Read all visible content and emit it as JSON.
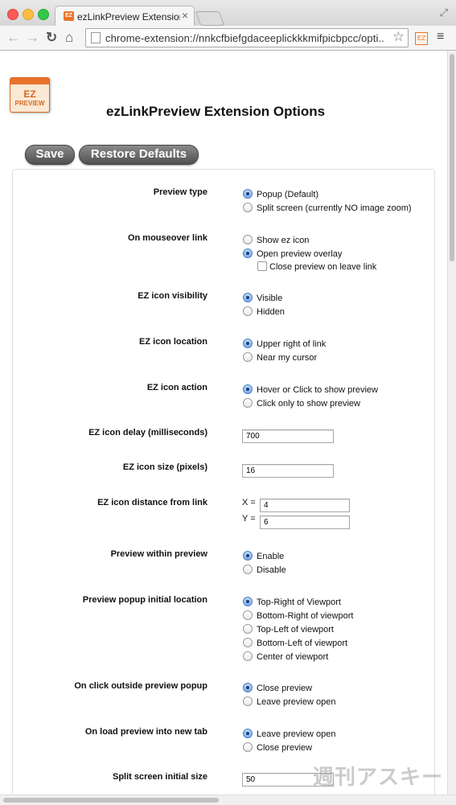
{
  "browser": {
    "tab_title": "ezLinkPreview Extension",
    "tab_close": "×",
    "url": "chrome-extension://nnkcfbiefgdaceeplickkkmifpicbpcc/opti...",
    "ext_badge": "EZ",
    "fullscreen_glyph": "⤢",
    "back_glyph": "←",
    "forward_glyph": "→",
    "reload_glyph": "↻",
    "home_glyph": "⌂",
    "star_glyph": "☆",
    "menu_glyph": "≡"
  },
  "logo": {
    "line1": "EZ",
    "line2": "PREVIEW",
    "bar_color": "#e8742a"
  },
  "page_title": "ezLinkPreview Extension Options",
  "buttons": {
    "save": "Save",
    "restore": "Restore Defaults"
  },
  "settings": {
    "preview_type": {
      "label": "Preview type",
      "options": [
        "Popup (Default)",
        "Split screen (currently NO image zoom)"
      ],
      "selected": 0
    },
    "mouseover": {
      "label": "On mouseover link",
      "options": [
        "Show ez icon",
        "Open preview overlay"
      ],
      "selected": 1,
      "checkbox": "Close preview on leave link",
      "checkbox_checked": false
    },
    "icon_visibility": {
      "label": "EZ icon visibility",
      "options": [
        "Visible",
        "Hidden"
      ],
      "selected": 0
    },
    "icon_location": {
      "label": "EZ icon location",
      "options": [
        "Upper right of link",
        "Near my cursor"
      ],
      "selected": 0
    },
    "icon_action": {
      "label": "EZ icon action",
      "options": [
        "Hover or Click to show preview",
        "Click only to show preview"
      ],
      "selected": 0
    },
    "icon_delay": {
      "label": "EZ icon delay (milliseconds)",
      "value": "700"
    },
    "icon_size": {
      "label": "EZ icon size (pixels)",
      "value": "16"
    },
    "icon_distance": {
      "label": "EZ icon distance from link",
      "x_label": "X =",
      "x_value": "4",
      "y_label": "Y =",
      "y_value": "6"
    },
    "preview_within": {
      "label": "Preview within preview",
      "options": [
        "Enable",
        "Disable"
      ],
      "selected": 0
    },
    "popup_location": {
      "label": "Preview popup initial location",
      "options": [
        "Top-Right of Viewport",
        "Bottom-Right of viewport",
        "Top-Left of viewport",
        "Bottom-Left of viewport",
        "Center of viewport"
      ],
      "selected": 0
    },
    "click_outside": {
      "label": "On click outside preview popup",
      "options": [
        "Close preview",
        "Leave preview open"
      ],
      "selected": 0
    },
    "load_new_tab": {
      "label": "On load preview into new tab",
      "options": [
        "Leave preview open",
        "Close preview"
      ],
      "selected": 0
    },
    "split_size": {
      "label": "Split screen initial size",
      "value": "50"
    }
  },
  "watermark": "週刊アスキー"
}
